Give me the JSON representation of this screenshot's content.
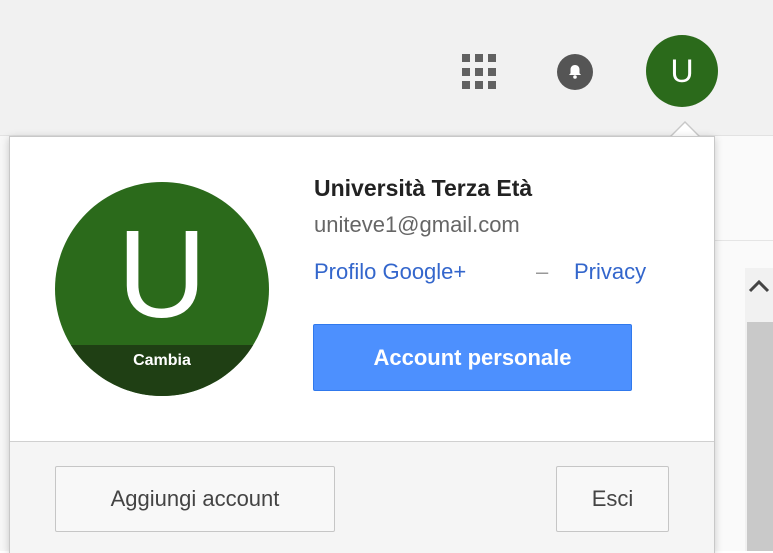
{
  "header": {
    "avatar_letter": "U"
  },
  "account": {
    "avatar_letter": "U",
    "change_label": "Cambia",
    "name": "Università Terza Età",
    "email": "uniteve1@gmail.com",
    "profile_link": "Profilo Google+",
    "separator": "–",
    "privacy_link": "Privacy",
    "account_button": "Account personale"
  },
  "footer": {
    "add_account": "Aggiungi account",
    "sign_out": "Esci"
  },
  "icons": {
    "apps": "apps-grid-icon",
    "notifications": "bell-icon",
    "scroll_up": "chevron-up-icon"
  },
  "colors": {
    "avatar": "#2b6a1b",
    "avatar_band": "#1f3f14",
    "primary_button": "#4d90fe",
    "link": "#3366cc"
  }
}
